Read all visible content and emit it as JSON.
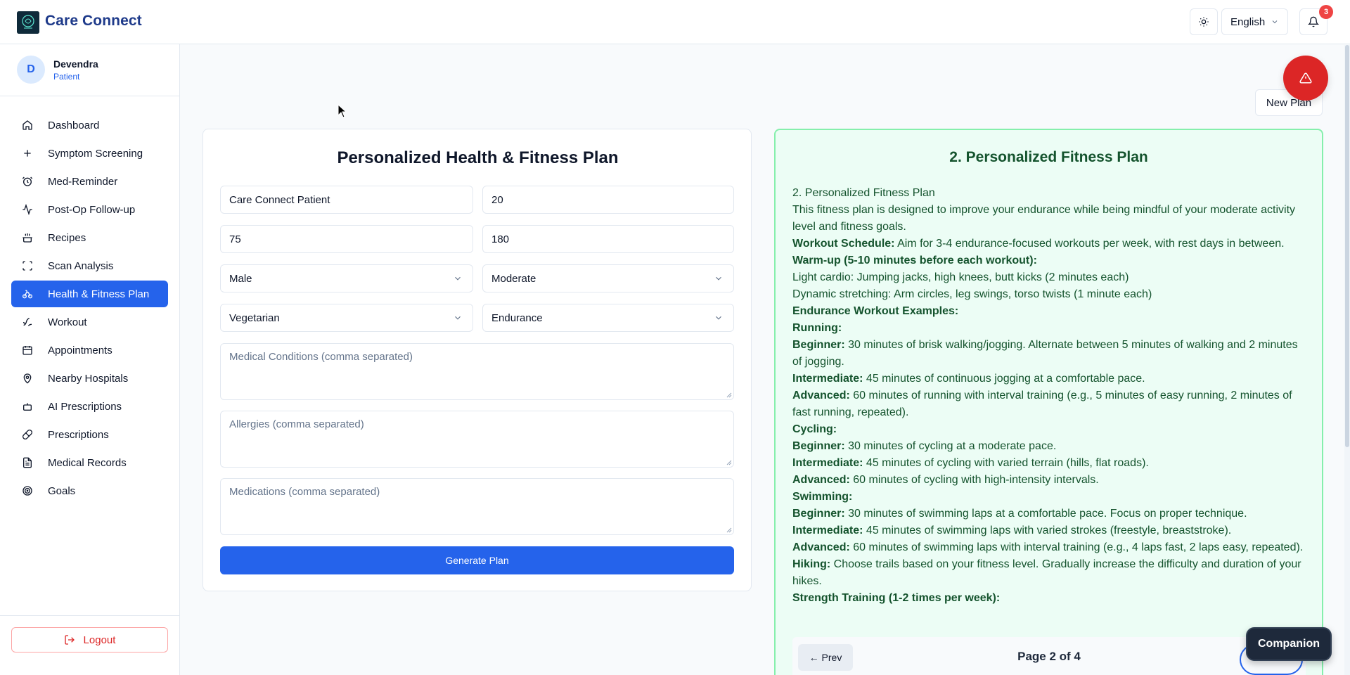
{
  "header": {
    "app_title": "Care Connect",
    "language": "English",
    "notification_count": "3"
  },
  "user": {
    "initial": "D",
    "name": "Devendra",
    "role": "Patient"
  },
  "sidebar": {
    "items": [
      {
        "label": "Dashboard",
        "icon": "home-icon"
      },
      {
        "label": "Symptom Screening",
        "icon": "plus-icon"
      },
      {
        "label": "Med-Reminder",
        "icon": "alarm-clock-icon"
      },
      {
        "label": "Post-Op Follow-up",
        "icon": "activity-icon"
      },
      {
        "label": "Recipes",
        "icon": "cooking-pot-icon"
      },
      {
        "label": "Scan Analysis",
        "icon": "scan-icon"
      },
      {
        "label": "Health & Fitness Plan",
        "icon": "bike-icon",
        "active": true
      },
      {
        "label": "Workout",
        "icon": "dumbbell-icon"
      },
      {
        "label": "Appointments",
        "icon": "calendar-icon"
      },
      {
        "label": "Nearby Hospitals",
        "icon": "map-pin-icon"
      },
      {
        "label": "AI Prescriptions",
        "icon": "robot-icon"
      },
      {
        "label": "Prescriptions",
        "icon": "pill-icon"
      },
      {
        "label": "Medical Records",
        "icon": "file-text-icon"
      },
      {
        "label": "Goals",
        "icon": "target-icon"
      }
    ],
    "logout_label": "Logout"
  },
  "main": {
    "new_plan_label": "New Plan",
    "form": {
      "title": "Personalized Health & Fitness Plan",
      "name_value": "Care Connect Patient",
      "age_value": "20",
      "weight_value": "75",
      "height_value": "180",
      "gender_value": "Male",
      "activity_value": "Moderate",
      "diet_value": "Vegetarian",
      "goal_value": "Endurance",
      "conditions_placeholder": "Medical Conditions (comma separated)",
      "allergies_placeholder": "Allergies (comma separated)",
      "medications_placeholder": "Medications (comma separated)",
      "generate_label": "Generate Plan"
    },
    "plan": {
      "title": "2. Personalized Fitness Plan",
      "lines": [
        {
          "text": "2. Personalized Fitness Plan"
        },
        {
          "text": "This fitness plan is designed to improve your endurance while being mindful of your moderate activity level and fitness goals."
        },
        {
          "bold": "Workout Schedule:",
          "text": " Aim for 3-4 endurance-focused workouts per week, with rest days in between."
        },
        {
          "bold": "Warm-up (5-10 minutes before each workout):",
          "text": ""
        },
        {
          "text": "Light cardio: Jumping jacks, high knees, butt kicks (2 minutes each)"
        },
        {
          "text": "Dynamic stretching: Arm circles, leg swings, torso twists (1 minute each)"
        },
        {
          "bold": "Endurance Workout Examples:",
          "text": ""
        },
        {
          "bold": "Running:",
          "text": ""
        },
        {
          "bold": "Beginner:",
          "text": " 30 minutes of brisk walking/jogging. Alternate between 5 minutes of walking and 2 minutes of jogging."
        },
        {
          "bold": "Intermediate:",
          "text": " 45 minutes of continuous jogging at a comfortable pace."
        },
        {
          "bold": "Advanced:",
          "text": " 60 minutes of running with interval training (e.g., 5 minutes of easy running, 2 minutes of fast running, repeated)."
        },
        {
          "bold": "Cycling:",
          "text": ""
        },
        {
          "bold": "Beginner:",
          "text": " 30 minutes of cycling at a moderate pace."
        },
        {
          "bold": "Intermediate:",
          "text": " 45 minutes of cycling with varied terrain (hills, flat roads)."
        },
        {
          "bold": "Advanced:",
          "text": " 60 minutes of cycling with high-intensity intervals."
        },
        {
          "bold": "Swimming:",
          "text": ""
        },
        {
          "bold": "Beginner:",
          "text": " 30 minutes of swimming laps at a comfortable pace. Focus on proper technique."
        },
        {
          "bold": "Intermediate:",
          "text": " 45 minutes of swimming laps with varied strokes (freestyle, breaststroke)."
        },
        {
          "bold": "Advanced:",
          "text": " 60 minutes of swimming laps with interval training (e.g., 4 laps fast, 2 laps easy, repeated)."
        },
        {
          "bold": "Hiking:",
          "text": " Choose trails based on your fitness level. Gradually increase the difficulty and duration of your hikes."
        },
        {
          "bold": "Strength Training (1-2 times per week):",
          "text": ""
        }
      ],
      "prev_label": "← Prev",
      "page_label": "Page 2 of 4"
    },
    "companion_label": "Companion"
  },
  "colors": {
    "primary": "#2563eb",
    "danger": "#dc2626",
    "plan_bg": "#ecfdf5",
    "plan_border": "#86efac"
  }
}
